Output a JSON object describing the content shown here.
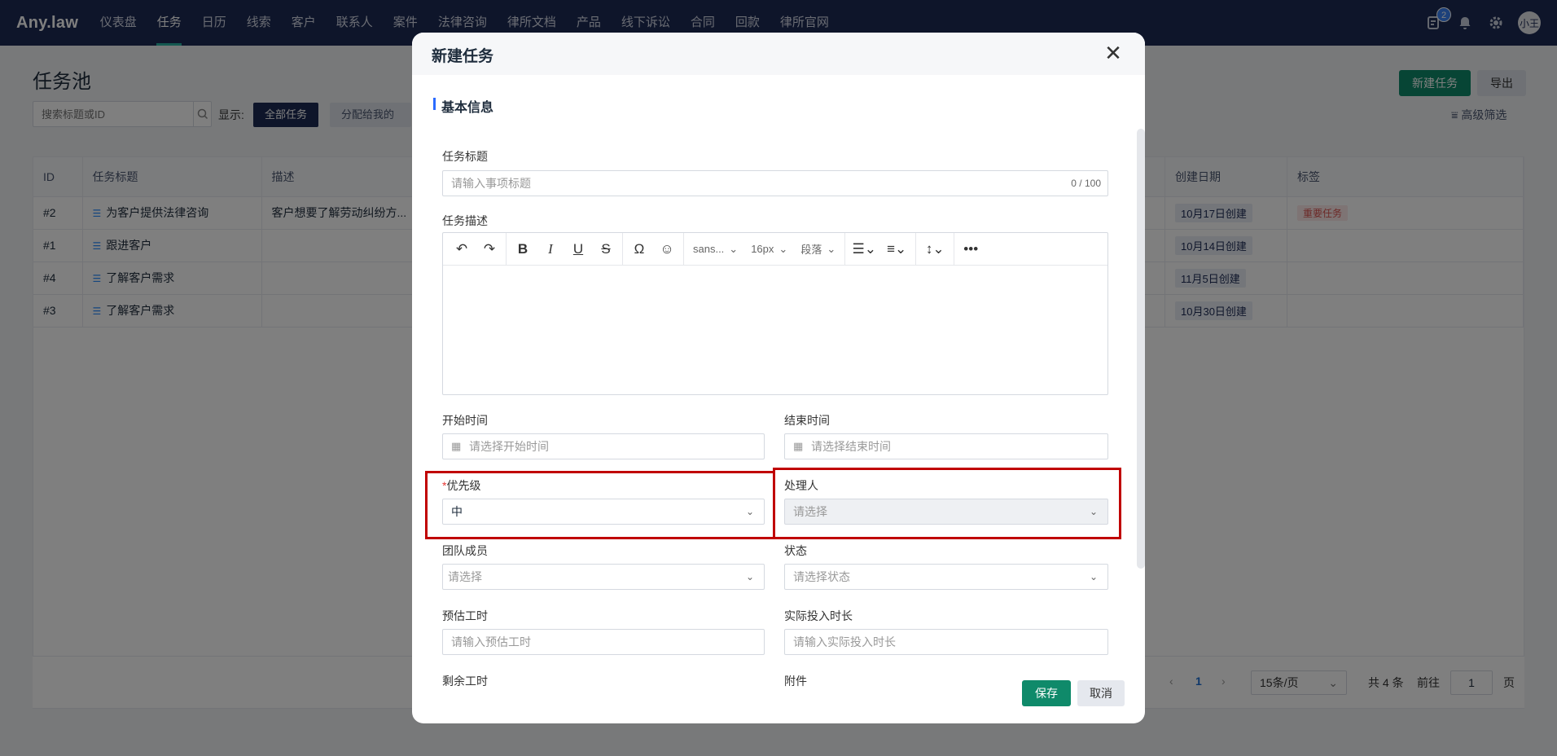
{
  "app": {
    "logo": "Any.law",
    "nav": [
      "仪表盘",
      "任务",
      "日历",
      "线索",
      "客户",
      "联系人",
      "案件",
      "法律咨询",
      "律所文档",
      "产品",
      "线下诉讼",
      "合同",
      "回款",
      "律所官网"
    ],
    "active_nav": "任务",
    "notification_count": "2",
    "avatar_text": "小王"
  },
  "page": {
    "title": "任务池",
    "search_placeholder": "搜索标题或ID",
    "show_label": "显示:",
    "filters": [
      "全部任务",
      "分配给我的"
    ],
    "new_task_button": "新建任务",
    "export_button": "导出",
    "advanced_filter": "高级筛选"
  },
  "table": {
    "columns": [
      "ID",
      "任务标题",
      "描述",
      "创建日期",
      "标签"
    ],
    "rows": [
      {
        "id": "#2",
        "title": "为客户提供法律咨询",
        "desc": "客户想要了解劳动纠纷方...",
        "created": "10月17日创建",
        "tag": "重要任务"
      },
      {
        "id": "#1",
        "title": "跟进客户",
        "desc": "",
        "created": "10月14日创建",
        "tag": ""
      },
      {
        "id": "#4",
        "title": "了解客户需求",
        "desc": "",
        "created": "11月5日创建",
        "tag": ""
      },
      {
        "id": "#3",
        "title": "了解客户需求",
        "desc": "",
        "created": "10月30日创建",
        "tag": ""
      }
    ]
  },
  "pagination": {
    "current_page": "1",
    "page_size": "15条/页",
    "total": "共 4 条",
    "goto_label": "前往",
    "goto_value": "1",
    "page_suffix": "页"
  },
  "modal": {
    "title": "新建任务",
    "section": "基本信息",
    "task_title_label": "任务标题",
    "task_title_placeholder": "请输入事项标题",
    "task_title_counter": "0 / 100",
    "desc_label": "任务描述",
    "editor_font": "sans...",
    "editor_size": "16px",
    "editor_block": "段落",
    "start_label": "开始时间",
    "start_placeholder": "请选择开始时间",
    "end_label": "结束时间",
    "end_placeholder": "请选择结束时间",
    "priority_label": "优先级",
    "priority_value": "中",
    "assignee_label": "处理人",
    "assignee_placeholder": "请选择",
    "team_label": "团队成员",
    "team_placeholder": "请选择",
    "status_label": "状态",
    "status_placeholder": "请选择状态",
    "estimate_label": "预估工时",
    "estimate_placeholder": "请输入预估工时",
    "actual_label": "实际投入时长",
    "actual_placeholder": "请输入实际投入时长",
    "remaining_label": "剩余工时",
    "attachment_label": "附件",
    "save_button": "保存",
    "cancel_button": "取消"
  },
  "colors": {
    "nav_bg": "#1c2a55",
    "primary_green": "#0f8a6a",
    "highlight_red": "#c00000"
  }
}
